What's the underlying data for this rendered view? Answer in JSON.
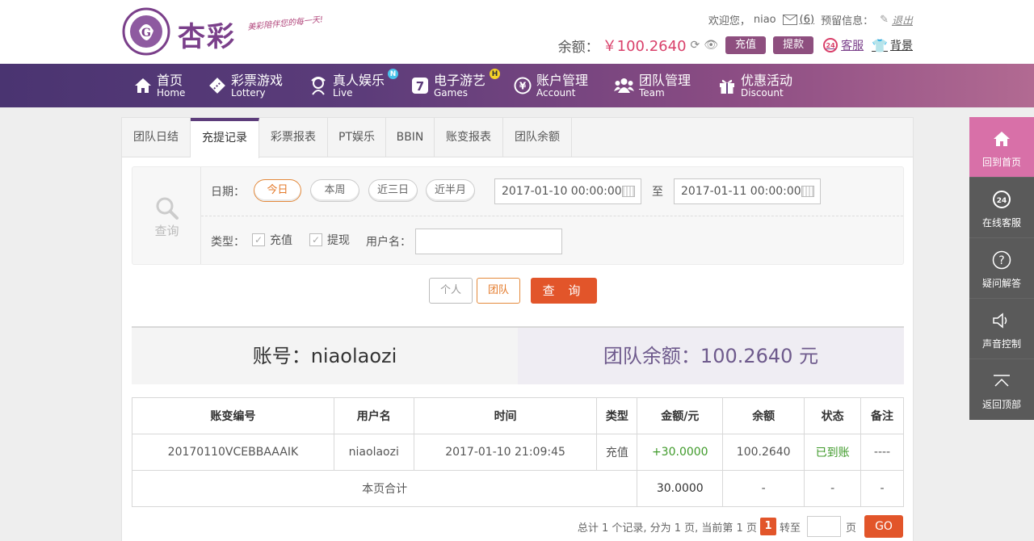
{
  "brand": {
    "name": "杏彩",
    "slogan": "美彩陪伴您的每一天!"
  },
  "header": {
    "welcome": "欢迎您，",
    "username": "niao",
    "messages": "(6)",
    "reserved": "预留信息：",
    "logout": "退出",
    "balance_label": "余额：",
    "balance_value": "￥100.2640",
    "deposit": "充值",
    "withdraw": "提款",
    "service_badge": "24",
    "service": "客服",
    "background": "背景"
  },
  "nav": [
    {
      "cn": "首页",
      "en": "Home",
      "icon": "home-icon"
    },
    {
      "cn": "彩票游戏",
      "en": "Lottery",
      "icon": "lottery-icon"
    },
    {
      "cn": "真人娱乐",
      "en": "Live",
      "icon": "live-icon",
      "badge": "N"
    },
    {
      "cn": "电子游艺",
      "en": "Games",
      "icon": "slot-7-icon",
      "badge": "H"
    },
    {
      "cn": "账户管理",
      "en": "Account",
      "icon": "account-yen-icon"
    },
    {
      "cn": "团队管理",
      "en": "Team",
      "icon": "team-icon"
    },
    {
      "cn": "优惠活动",
      "en": "Discount",
      "icon": "gift-icon"
    }
  ],
  "tabs": [
    "团队日结",
    "充提记录",
    "彩票报表",
    "PT娱乐",
    "BBIN",
    "账变报表",
    "团队余额"
  ],
  "query": {
    "panel_label": "查询",
    "date_label": "日期：",
    "ranges": [
      "今日",
      "本周",
      "近三日",
      "近半月"
    ],
    "start": "2017-01-10 00:00:00",
    "to": "至",
    "end": "2017-01-11 00:00:00",
    "type_label": "类型：",
    "type_deposit": "充值",
    "type_withdraw": "提现",
    "username_label": "用户名：",
    "username_value": "",
    "btn_personal": "个人",
    "btn_team": "团队",
    "btn_query": "查 询"
  },
  "account": {
    "account_text": "账号：niaolaozi",
    "team_balance_text": "团队余额：100.2640 元"
  },
  "table": {
    "headers": [
      "账变编号",
      "用户名",
      "时间",
      "类型",
      "金额/元",
      "余额",
      "状态",
      "备注"
    ],
    "rows": [
      [
        "20170110VCEBBAAAIK",
        "niaolaozi",
        "2017-01-10 21:09:45",
        "充值",
        "+30.0000",
        "100.2640",
        "已到账",
        "----"
      ]
    ],
    "subtotal_label": "本页合计",
    "subtotal_amount": "30.0000",
    "subtotal_dash": "-"
  },
  "pager": {
    "summary": "总计 1 个记录, 分为 1 页, 当前第 1 页",
    "current": "1",
    "goto": "转至",
    "page_unit": "页",
    "go": "GO"
  },
  "sidebar": [
    {
      "label": "回到首页",
      "icon": "home-icon"
    },
    {
      "label": "在线客服",
      "icon": "headset-24-icon"
    },
    {
      "label": "疑问解答",
      "icon": "question-icon"
    },
    {
      "label": "声音控制",
      "icon": "speaker-icon"
    },
    {
      "label": "返回顶部",
      "icon": "back-to-top-icon"
    }
  ],
  "colors": {
    "accent_orange": "#e2552a",
    "purple": "#5c3c7a",
    "pink": "#d870a8",
    "green": "#3f9a2a"
  }
}
